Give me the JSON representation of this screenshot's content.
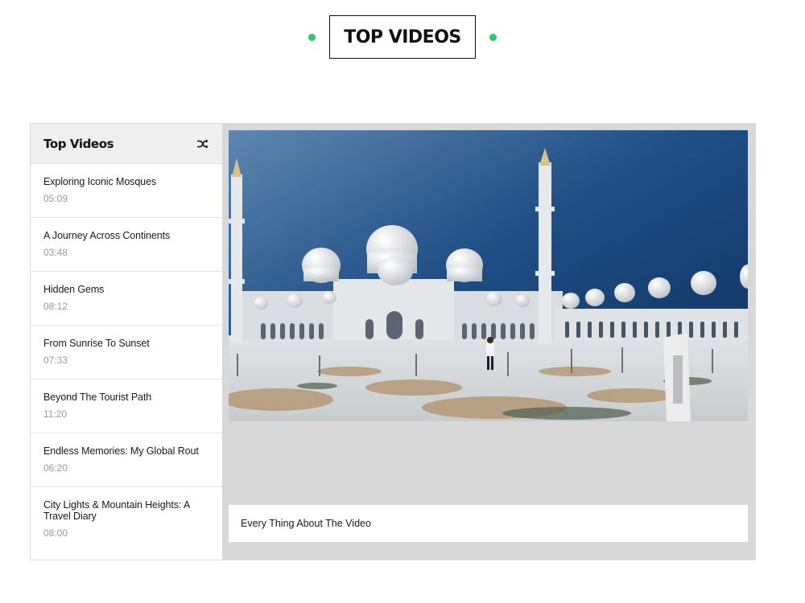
{
  "heading": {
    "title": "TOP VIDEOS",
    "accent_color": "#2ec866"
  },
  "sidebar": {
    "title": "Top Videos",
    "shuffle_icon": "shuffle-icon",
    "items": [
      {
        "title": "Exploring Iconic Mosques",
        "duration": "05:09"
      },
      {
        "title": "A Journey Across Continents",
        "duration": "03:48"
      },
      {
        "title": "Hidden Gems",
        "duration": "08:12"
      },
      {
        "title": "From Sunrise To Sunset",
        "duration": "07:33"
      },
      {
        "title": "Beyond The Tourist Path",
        "duration": "11:20"
      },
      {
        "title": "Endless Memories: My Global Rout",
        "duration": "06:20"
      },
      {
        "title": "City Lights & Mountain Heights: A Travel Diary",
        "duration": "08:00"
      }
    ]
  },
  "player": {
    "caption": "Every Thing About The Video",
    "thumbnail": "white mosque courtyard under blue sky"
  }
}
